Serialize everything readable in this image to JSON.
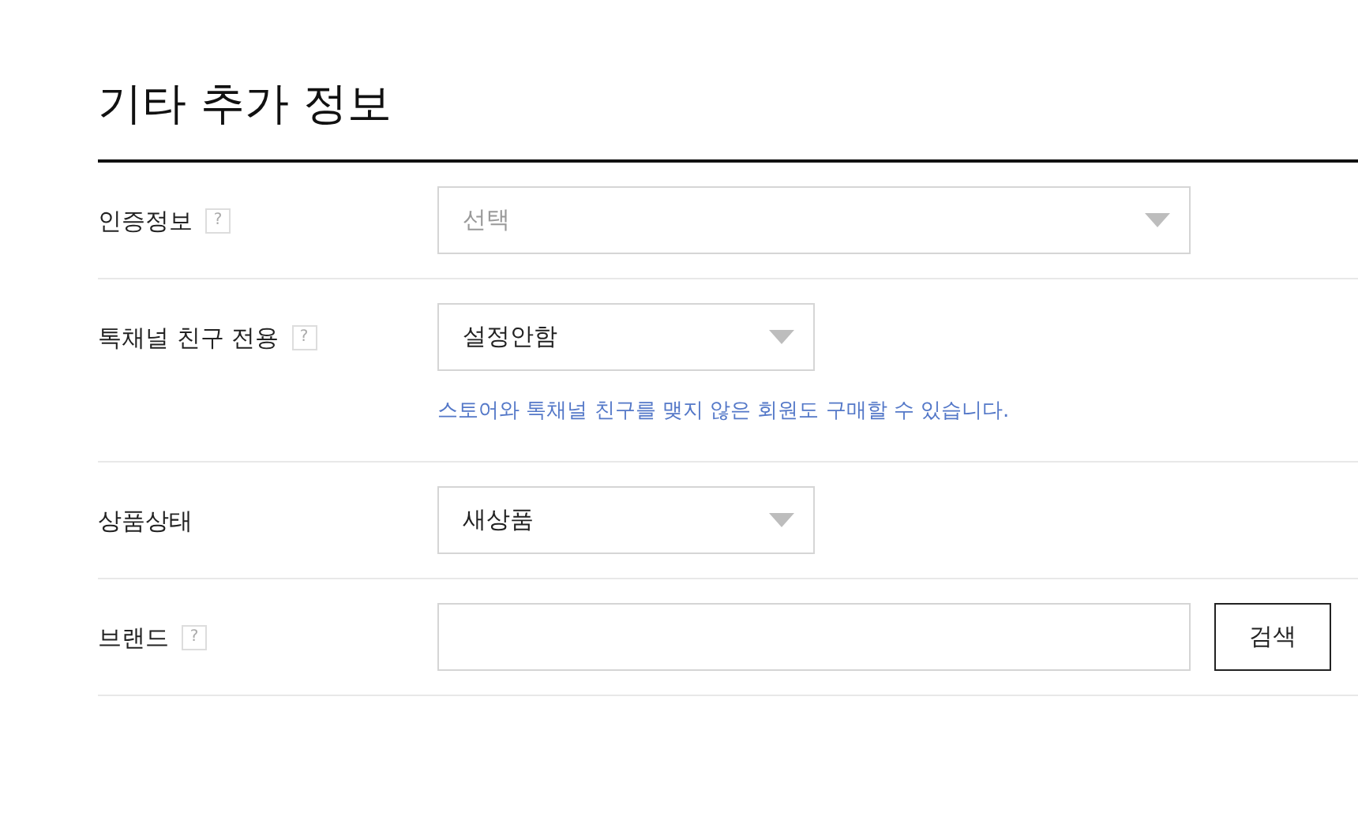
{
  "title": "기타 추가 정보",
  "rows": [
    {
      "kind": "wideselect",
      "label": "인증정보",
      "help": "?",
      "placeholder": "선택"
    },
    {
      "kind": "select",
      "label": "톡채널 친구 전용",
      "help": "?",
      "value": "설정안함",
      "note": "스토어와 톡채널 친구를 맺지 않은 회원도 구매할 수 있습니다."
    },
    {
      "kind": "select",
      "label": "상품상태",
      "value": "새상품"
    },
    {
      "kind": "search",
      "label": "브랜드",
      "help": "?",
      "button": "검색"
    }
  ]
}
